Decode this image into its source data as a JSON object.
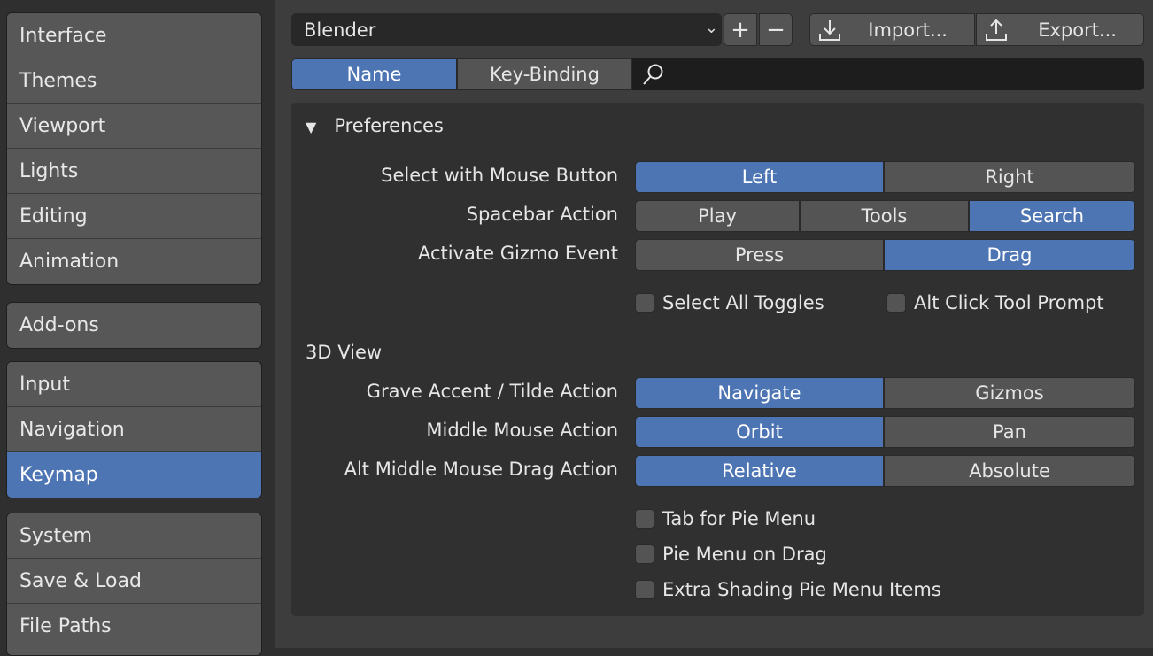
{
  "sidebar": {
    "group1": [
      "Interface",
      "Themes",
      "Viewport",
      "Lights",
      "Editing",
      "Animation"
    ],
    "group2": [
      "Add-ons"
    ],
    "group3": [
      "Input",
      "Navigation",
      "Keymap"
    ],
    "group4": [
      "System",
      "Save & Load",
      "File Paths"
    ],
    "active": "Keymap"
  },
  "toolbar": {
    "preset": "Blender",
    "add_label": "+",
    "remove_label": "−",
    "import_label": "Import...",
    "export_label": "Export..."
  },
  "filter": {
    "name_tab": "Name",
    "keybinding_tab": "Key-Binding",
    "search_value": ""
  },
  "panel": {
    "title": "Preferences",
    "rows": [
      {
        "label": "Select with Mouse Button",
        "options": [
          "Left",
          "Right"
        ],
        "selected": "Left"
      },
      {
        "label": "Spacebar Action",
        "options": [
          "Play",
          "Tools",
          "Search"
        ],
        "selected": "Search"
      },
      {
        "label": "Activate Gizmo Event",
        "options": [
          "Press",
          "Drag"
        ],
        "selected": "Drag"
      }
    ],
    "checks1": [
      "Select All Toggles",
      "Alt Click Tool Prompt"
    ],
    "section_3d": "3D View",
    "rows3d": [
      {
        "label": "Grave Accent / Tilde Action",
        "options": [
          "Navigate",
          "Gizmos"
        ],
        "selected": "Navigate"
      },
      {
        "label": "Middle Mouse Action",
        "options": [
          "Orbit",
          "Pan"
        ],
        "selected": "Orbit"
      },
      {
        "label": "Alt Middle Mouse Drag Action",
        "options": [
          "Relative",
          "Absolute"
        ],
        "selected": "Relative"
      }
    ],
    "checks2": [
      "Tab for Pie Menu",
      "Pie Menu on Drag",
      "Extra Shading Pie Menu Items"
    ]
  },
  "colors": {
    "accent": "#4d74b3",
    "button": "#545454",
    "panel": "#303030",
    "background": "#3d3d3d"
  }
}
